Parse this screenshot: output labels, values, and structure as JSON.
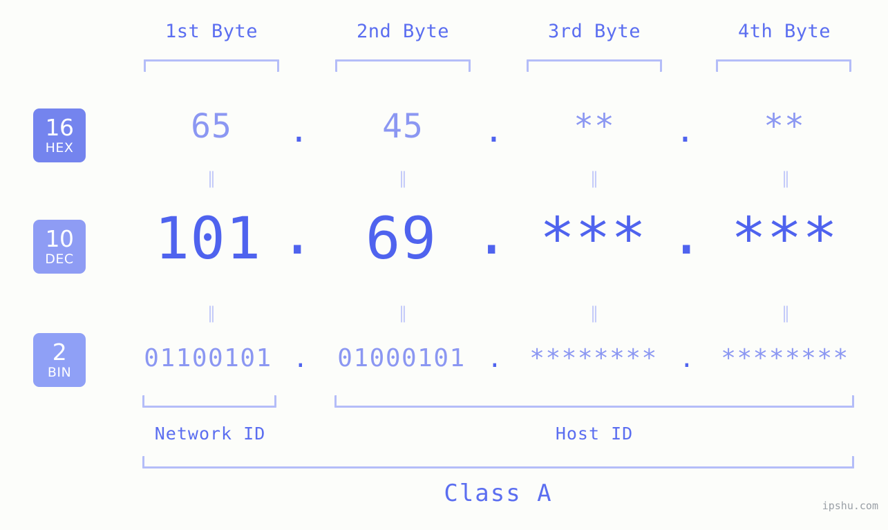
{
  "background_color": "#fcfdfa",
  "accent_strong": "#4f63ee",
  "accent_mid": "#5b6ef0",
  "accent_soft": "#8b97f2",
  "accent_light": "#b4bdf8",
  "byte_headers": [
    {
      "label": "1st Byte"
    },
    {
      "label": "2nd Byte"
    },
    {
      "label": "3rd Byte"
    },
    {
      "label": "4th Byte"
    }
  ],
  "bases": [
    {
      "number": "16",
      "abbr": "HEX",
      "color": "#7484ee"
    },
    {
      "number": "10",
      "abbr": "DEC",
      "color": "#8e9cf4"
    },
    {
      "number": "2",
      "abbr": "BIN",
      "color": "#8fa0f6"
    }
  ],
  "rows": {
    "hex": {
      "base_number": "16",
      "base_abbr": "HEX",
      "values": [
        "65",
        "45",
        "**",
        "**"
      ],
      "separator": "."
    },
    "dec": {
      "base_number": "10",
      "base_abbr": "DEC",
      "values": [
        "101",
        "69",
        "***",
        "***"
      ],
      "separator": "."
    },
    "bin": {
      "base_number": "2",
      "base_abbr": "BIN",
      "values": [
        "01100101",
        "01000101",
        "********",
        "********"
      ],
      "separator": "."
    }
  },
  "equality_marks": {
    "glyph": "‖",
    "count_per_gap": 4
  },
  "segments": {
    "network_id": "Network ID",
    "host_id": "Host ID",
    "class": "Class A"
  },
  "watermark": "ipshu.com"
}
